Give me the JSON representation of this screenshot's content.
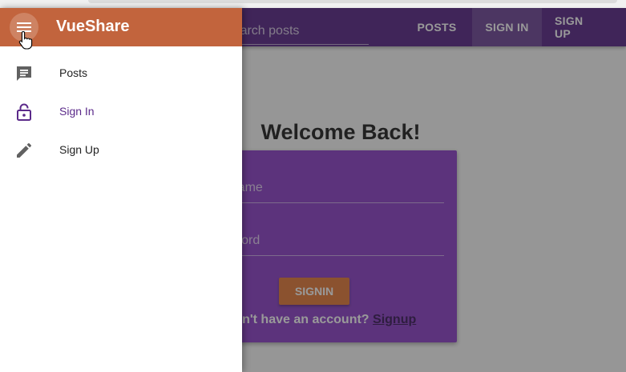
{
  "toolbar": {
    "search_placeholder": "Search posts",
    "nav": {
      "posts": "POSTS",
      "signin": "SIGN IN",
      "signup": "SIGN UP"
    }
  },
  "main": {
    "welcome": "Welcome Back!",
    "form": {
      "username_placeholder": "Username",
      "password_placeholder": "Password",
      "signin_label": "SIGNIN",
      "signup_prompt": "Don't have an account?",
      "signup_link": "Signup"
    }
  },
  "drawer": {
    "brand": "VueShare",
    "items": [
      {
        "label": "Posts",
        "icon": "chat-icon"
      },
      {
        "label": "Sign In",
        "icon": "lock-open-icon",
        "active": true
      },
      {
        "label": "Sign Up",
        "icon": "pencil-icon"
      }
    ]
  },
  "colors": {
    "primary": "#5b2a8a",
    "accent": "#c2643d",
    "card": "#8e44c9",
    "button": "#e67c3c"
  }
}
